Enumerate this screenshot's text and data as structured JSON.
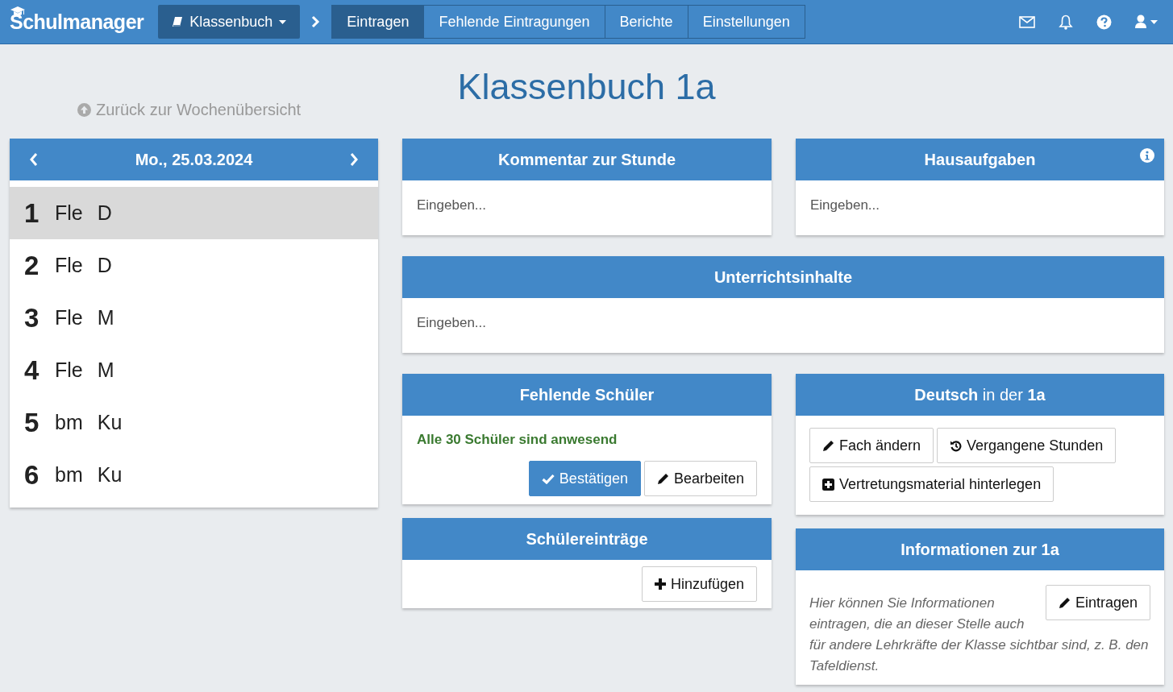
{
  "navbar": {
    "brand": "Schulmanager",
    "module_menu": "Klassenbuch",
    "tabs": [
      {
        "label": "Eintragen",
        "selected": true
      },
      {
        "label": "Fehlende Eintragungen",
        "selected": false
      },
      {
        "label": "Berichte",
        "selected": false
      },
      {
        "label": "Einstellungen",
        "selected": false
      }
    ]
  },
  "page_title": "Klassenbuch 1a",
  "back_link": "Zurück zur Wochenübersicht",
  "day": {
    "date": "Mo., 25.03.2024",
    "lessons": [
      {
        "number": "1",
        "teacher": "Fle",
        "subject": "D",
        "selected": true
      },
      {
        "number": "2",
        "teacher": "Fle",
        "subject": "D",
        "selected": false
      },
      {
        "number": "3",
        "teacher": "Fle",
        "subject": "M",
        "selected": false
      },
      {
        "number": "4",
        "teacher": "Fle",
        "subject": "M",
        "selected": false
      },
      {
        "number": "5",
        "teacher": "bm",
        "subject": "Ku",
        "selected": false
      },
      {
        "number": "6",
        "teacher": "bm",
        "subject": "Ku",
        "selected": false
      }
    ]
  },
  "comment": {
    "title": "Kommentar zur Stunde",
    "placeholder": "Eingeben..."
  },
  "homework": {
    "title": "Hausaufgaben",
    "placeholder": "Eingeben..."
  },
  "contents": {
    "title": "Unterrichtsinhalte",
    "placeholder": "Eingeben..."
  },
  "absent": {
    "title": "Fehlende Schüler",
    "status": "Alle 30 Schüler sind anwesend",
    "buttons": [
      {
        "label": "Bestätigen",
        "kind": "confirm"
      },
      {
        "label": "Bearbeiten",
        "kind": "edit"
      }
    ]
  },
  "student_entries": {
    "title": "Schülereinträge",
    "buttons": [
      {
        "label": "Hinzufügen",
        "kind": "add"
      }
    ]
  },
  "subject": {
    "title": "**Deutsch** in der **1a**",
    "buttons": [
      {
        "label": "Fach ändern",
        "kind": "edit"
      },
      {
        "label": "Vergangene Stunden",
        "kind": "history"
      },
      {
        "label": "Vertretungsmaterial hinterlegen",
        "kind": "addbox"
      }
    ]
  },
  "info": {
    "title": "Informationen zur 1a",
    "text_lines": [
      "Hier können Sie Informationen eintragen, die an dieser Stelle auch",
      "für andere Lehrkräfte der Klasse sichtbar sind, z. B. den Tafeldienst."
    ],
    "buttons": [
      {
        "label": "Eintragen",
        "kind": "edit"
      }
    ]
  }
}
